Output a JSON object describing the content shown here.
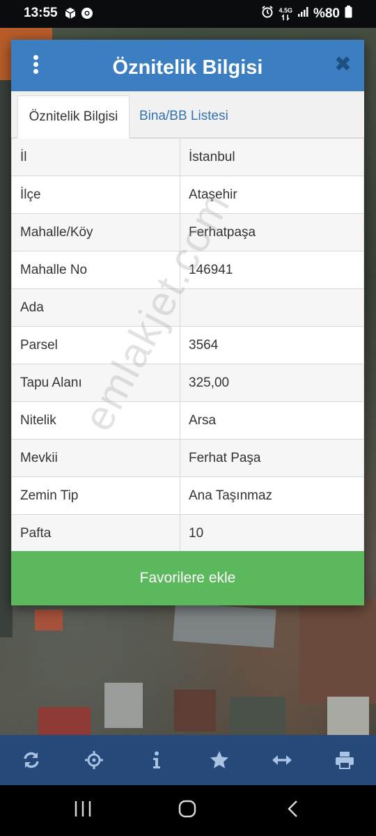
{
  "status_bar": {
    "time": "13:55",
    "network": "4.5G",
    "battery": "%80",
    "icons": [
      "box-icon",
      "chrome-icon",
      "alarm-icon",
      "data-arrows-icon",
      "signal-icon",
      "battery-icon"
    ]
  },
  "dialog": {
    "title": "Öznitelik Bilgisi",
    "menu_icon": "kebab-menu-icon",
    "close_icon": "close-icon",
    "tabs": [
      {
        "label": "Öznitelik Bilgisi",
        "active": true
      },
      {
        "label": "Bina/BB Listesi",
        "active": false
      }
    ],
    "rows": [
      {
        "key": "İl",
        "value": "İstanbul"
      },
      {
        "key": "İlçe",
        "value": "Ataşehir"
      },
      {
        "key": "Mahalle/Köy",
        "value": "Ferhatpaşa"
      },
      {
        "key": "Mahalle No",
        "value": "146941"
      },
      {
        "key": "Ada",
        "value": ""
      },
      {
        "key": "Parsel",
        "value": "3564"
      },
      {
        "key": "Tapu Alanı",
        "value": "325,00"
      },
      {
        "key": "Nitelik",
        "value": "Arsa"
      },
      {
        "key": "Mevkii",
        "value": "Ferhat Paşa"
      },
      {
        "key": "Zemin Tip",
        "value": "Ana Taşınmaz"
      },
      {
        "key": "Pafta",
        "value": "10"
      }
    ],
    "favorite_button": "Favorilere ekle",
    "watermark": "emlakjet.com"
  },
  "toolbar": {
    "buttons": [
      "refresh-icon",
      "locate-icon",
      "info-icon",
      "star-icon",
      "measure-icon",
      "print-icon"
    ]
  },
  "nav": {
    "buttons": [
      "recents-icon",
      "home-icon",
      "back-icon"
    ]
  },
  "colors": {
    "header": "#3b7ec1",
    "close": "#1d4f80",
    "favorite": "#5cb85c",
    "toolbar": "#26497a",
    "tab_link": "#3372ad"
  }
}
